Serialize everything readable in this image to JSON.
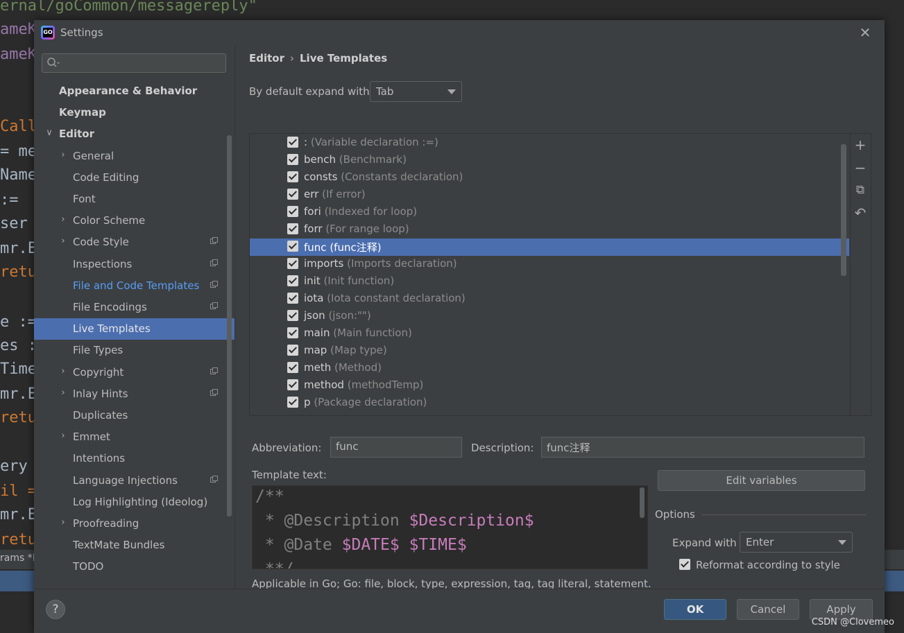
{
  "background_editor": {
    "lines": [
      {
        "text": "ernal/goCommon/messagereply\"",
        "color": "#6a8759"
      },
      {
        "text": "ameK",
        "color": "#9876aa"
      },
      {
        "text": "ameK",
        "color": "#9876aa"
      },
      {
        "text": "Call",
        "color": "#cc7832"
      },
      {
        "text": "= me",
        "color": "#a9b7c6"
      },
      {
        "text": "Name",
        "color": "#a9b7c6"
      },
      {
        "text": " :=",
        "color": "#a9b7c6"
      },
      {
        "text": "ser",
        "color": "#a9b7c6"
      },
      {
        "text": "mr.E",
        "color": "#a9b7c6"
      },
      {
        "text": "retu",
        "color": "#cc7832"
      },
      {
        "text": "e :=",
        "color": "#a9b7c6"
      },
      {
        "text": "es :",
        "color": "#a9b7c6"
      },
      {
        "text": "Time",
        "color": "#a9b7c6"
      },
      {
        "text": "mr.E",
        "color": "#a9b7c6"
      },
      {
        "text": "retu",
        "color": "#cc7832"
      },
      {
        "text": "ery",
        "color": "#a9b7c6"
      },
      {
        "text": "il =",
        "color": "#cc7832"
      },
      {
        "text": "mr.E",
        "color": "#a9b7c6"
      },
      {
        "text": "retu",
        "color": "#cc7832"
      }
    ],
    "status_text": "rams *N"
  },
  "watermark": "CSDN @Clovemeo",
  "dialog": {
    "title": "Settings",
    "logo_text": "GO",
    "close_glyph": "✕"
  },
  "sidebar": {
    "search": {
      "placeholder": "",
      "value": "",
      "icon": "search-icon"
    },
    "items": [
      {
        "label": "Appearance & Behavior",
        "level": 0,
        "bold": true,
        "chevron": "",
        "name": "sidebar-item-appearance-behavior"
      },
      {
        "label": "Keymap",
        "level": 0,
        "bold": true,
        "chevron": "",
        "name": "sidebar-item-keymap"
      },
      {
        "label": "Editor",
        "level": 0,
        "bold": true,
        "chevron": "∨",
        "name": "sidebar-item-editor"
      },
      {
        "label": "General",
        "level": 1,
        "chevron": "›",
        "name": "sidebar-item-general"
      },
      {
        "label": "Code Editing",
        "level": 1,
        "chevron": "",
        "name": "sidebar-item-code-editing"
      },
      {
        "label": "Font",
        "level": 1,
        "chevron": "",
        "name": "sidebar-item-font"
      },
      {
        "label": "Color Scheme",
        "level": 1,
        "chevron": "›",
        "name": "sidebar-item-color-scheme"
      },
      {
        "label": "Code Style",
        "level": 1,
        "chevron": "›",
        "project": true,
        "name": "sidebar-item-code-style"
      },
      {
        "label": "Inspections",
        "level": 1,
        "chevron": "",
        "project": true,
        "name": "sidebar-item-inspections"
      },
      {
        "label": "File and Code Templates",
        "level": 1,
        "chevron": "",
        "project": true,
        "link": true,
        "name": "sidebar-item-file-code-templates"
      },
      {
        "label": "File Encodings",
        "level": 1,
        "chevron": "",
        "project": true,
        "name": "sidebar-item-file-encodings"
      },
      {
        "label": "Live Templates",
        "level": 1,
        "chevron": "",
        "selected": true,
        "name": "sidebar-item-live-templates"
      },
      {
        "label": "File Types",
        "level": 1,
        "chevron": "",
        "name": "sidebar-item-file-types"
      },
      {
        "label": "Copyright",
        "level": 1,
        "chevron": "›",
        "project": true,
        "name": "sidebar-item-copyright"
      },
      {
        "label": "Inlay Hints",
        "level": 1,
        "chevron": "›",
        "project": true,
        "name": "sidebar-item-inlay-hints"
      },
      {
        "label": "Duplicates",
        "level": 1,
        "chevron": "",
        "name": "sidebar-item-duplicates"
      },
      {
        "label": "Emmet",
        "level": 1,
        "chevron": "›",
        "name": "sidebar-item-emmet"
      },
      {
        "label": "Intentions",
        "level": 1,
        "chevron": "",
        "name": "sidebar-item-intentions"
      },
      {
        "label": "Language Injections",
        "level": 1,
        "chevron": "",
        "project": true,
        "name": "sidebar-item-language-injections"
      },
      {
        "label": "Log Highlighting (Ideolog)",
        "level": 1,
        "chevron": "",
        "name": "sidebar-item-log-highlighting"
      },
      {
        "label": "Proofreading",
        "level": 1,
        "chevron": "›",
        "name": "sidebar-item-proofreading"
      },
      {
        "label": "TextMate Bundles",
        "level": 1,
        "chevron": "",
        "name": "sidebar-item-textmate-bundles"
      },
      {
        "label": "TODO",
        "level": 1,
        "chevron": "",
        "name": "sidebar-item-todo"
      }
    ]
  },
  "main": {
    "breadcrumb": {
      "parent": "Editor",
      "separator": "›",
      "current": "Live Templates"
    },
    "expand_default": {
      "label": "By default expand with",
      "value": "Tab"
    },
    "templates": [
      {
        "abbr": ":",
        "desc": "(Variable declaration :=)",
        "checked": true
      },
      {
        "abbr": "bench",
        "desc": "(Benchmark)",
        "checked": true
      },
      {
        "abbr": "consts",
        "desc": "(Constants declaration)",
        "checked": true
      },
      {
        "abbr": "err",
        "desc": "(If error)",
        "checked": true
      },
      {
        "abbr": "fori",
        "desc": "(Indexed for loop)",
        "checked": true
      },
      {
        "abbr": "forr",
        "desc": "(For range loop)",
        "checked": true
      },
      {
        "abbr": "func",
        "desc": "(func注释)",
        "checked": true,
        "selected": true
      },
      {
        "abbr": "imports",
        "desc": "(Imports declaration)",
        "checked": true
      },
      {
        "abbr": "init",
        "desc": "(Init function)",
        "checked": true
      },
      {
        "abbr": "iota",
        "desc": "(Iota constant declaration)",
        "checked": true
      },
      {
        "abbr": "json",
        "desc": "(json:\"\")",
        "checked": true
      },
      {
        "abbr": "main",
        "desc": "(Main function)",
        "checked": true
      },
      {
        "abbr": "map",
        "desc": "(Map type)",
        "checked": true
      },
      {
        "abbr": "meth",
        "desc": "(Method)",
        "checked": true
      },
      {
        "abbr": "method",
        "desc": "(methodTemp)",
        "checked": true
      },
      {
        "abbr": "p",
        "desc": "(Package declaration)",
        "checked": true
      }
    ],
    "toolbar": {
      "add": "+",
      "remove": "−",
      "copy": "⧉",
      "restore": "↶"
    },
    "abbreviation": {
      "label": "Abbreviation:",
      "value": "func"
    },
    "description": {
      "label": "Description:",
      "value": "func注释"
    },
    "template_text": {
      "label": "Template text:",
      "lines": [
        [
          {
            "t": "/**",
            "v": false
          }
        ],
        [
          {
            "t": " * @Description ",
            "v": false
          },
          {
            "t": "$Description$",
            "v": true
          }
        ],
        [
          {
            "t": " * @Date ",
            "v": false
          },
          {
            "t": "$DATE$",
            "v": true
          },
          {
            "t": " ",
            "v": false
          },
          {
            "t": "$TIME$",
            "v": true
          }
        ],
        [
          {
            "t": " **/",
            "v": false
          }
        ]
      ]
    },
    "edit_variables_label": "Edit variables",
    "options": {
      "label": "Options",
      "expand_with_label": "Expand with",
      "expand_with_value": "Enter",
      "reformat_label": "Reformat according to style",
      "reformat_checked": true
    },
    "applicable_text": "Applicable in Go; Go: file, block, type, expression, tag, tag literal, statement.",
    "applicable_link": "."
  },
  "footer": {
    "help": "?",
    "ok": "OK",
    "cancel": "Cancel",
    "apply": "Apply"
  }
}
